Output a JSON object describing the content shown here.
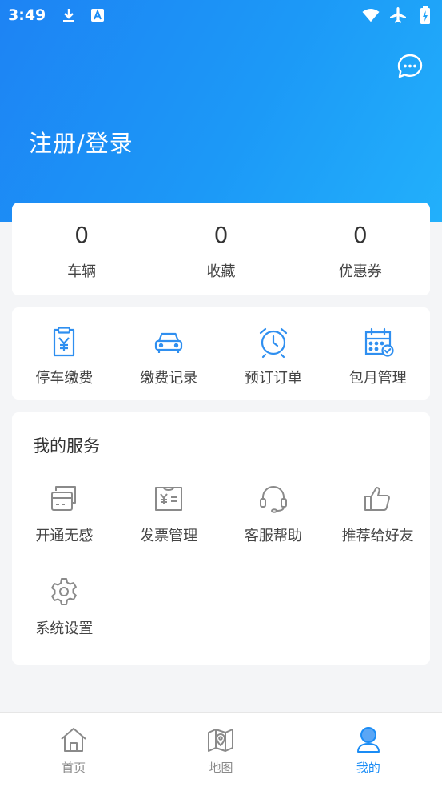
{
  "status_bar": {
    "time": "3:49",
    "left_icons": [
      "download-icon",
      "text-a-icon"
    ],
    "right_icons": [
      "wifi-icon",
      "airplane-icon",
      "battery-charging-icon"
    ]
  },
  "header": {
    "login_label": "注册/登录",
    "message_icon": "chat-bubble-icon",
    "gradient_colors": [
      "#1d83f4",
      "#22b0fb"
    ]
  },
  "stats": [
    {
      "value": "0",
      "label": "车辆"
    },
    {
      "value": "0",
      "label": "收藏"
    },
    {
      "value": "0",
      "label": "优惠券"
    }
  ],
  "quick_actions": [
    {
      "label": "停车缴费",
      "icon": "yen-clipboard-icon"
    },
    {
      "label": "缴费记录",
      "icon": "car-icon"
    },
    {
      "label": "预订订单",
      "icon": "alarm-clock-icon"
    },
    {
      "label": "包月管理",
      "icon": "calendar-check-icon"
    }
  ],
  "services": {
    "title": "我的服务",
    "items": [
      {
        "label": "开通无感",
        "icon": "card-icon"
      },
      {
        "label": "发票管理",
        "icon": "invoice-icon"
      },
      {
        "label": "客服帮助",
        "icon": "headset-icon"
      },
      {
        "label": "推荐给好友",
        "icon": "thumbs-up-icon"
      },
      {
        "label": "系统设置",
        "icon": "gear-icon"
      }
    ]
  },
  "tabbar": {
    "items": [
      {
        "label": "首页",
        "icon": "home-icon",
        "active": false
      },
      {
        "label": "地图",
        "icon": "map-icon",
        "active": false
      },
      {
        "label": "我的",
        "icon": "user-icon",
        "active": true
      }
    ],
    "active_color": "#1a8cf5",
    "inactive_color": "#8a8a8a"
  },
  "accent_color": "#2f8ff0"
}
